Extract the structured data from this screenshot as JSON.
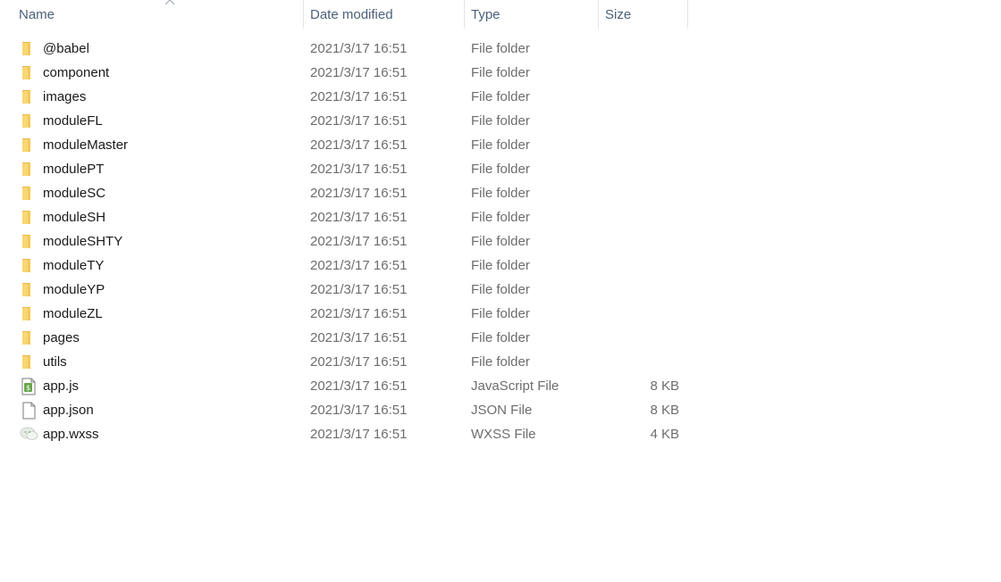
{
  "columns": {
    "name": "Name",
    "date": "Date modified",
    "type": "Type",
    "size": "Size"
  },
  "sort": {
    "column": "name",
    "direction": "ascending"
  },
  "colors": {
    "header_text": "#4c607a",
    "folder_yellow": "#f8d775",
    "folder_dark": "#e6b84a",
    "secondary_text": "#6d6d6d"
  },
  "files": [
    {
      "name": "@babel",
      "date": "2021/3/17 16:51",
      "type": "File folder",
      "size": "",
      "icon": "folder-icon"
    },
    {
      "name": "component",
      "date": "2021/3/17 16:51",
      "type": "File folder",
      "size": "",
      "icon": "folder-icon"
    },
    {
      "name": "images",
      "date": "2021/3/17 16:51",
      "type": "File folder",
      "size": "",
      "icon": "folder-icon"
    },
    {
      "name": "moduleFL",
      "date": "2021/3/17 16:51",
      "type": "File folder",
      "size": "",
      "icon": "folder-icon"
    },
    {
      "name": "moduleMaster",
      "date": "2021/3/17 16:51",
      "type": "File folder",
      "size": "",
      "icon": "folder-icon"
    },
    {
      "name": "modulePT",
      "date": "2021/3/17 16:51",
      "type": "File folder",
      "size": "",
      "icon": "folder-icon"
    },
    {
      "name": "moduleSC",
      "date": "2021/3/17 16:51",
      "type": "File folder",
      "size": "",
      "icon": "folder-icon"
    },
    {
      "name": "moduleSH",
      "date": "2021/3/17 16:51",
      "type": "File folder",
      "size": "",
      "icon": "folder-icon"
    },
    {
      "name": "moduleSHTY",
      "date": "2021/3/17 16:51",
      "type": "File folder",
      "size": "",
      "icon": "folder-icon"
    },
    {
      "name": "moduleTY",
      "date": "2021/3/17 16:51",
      "type": "File folder",
      "size": "",
      "icon": "folder-icon"
    },
    {
      "name": "moduleYP",
      "date": "2021/3/17 16:51",
      "type": "File folder",
      "size": "",
      "icon": "folder-icon"
    },
    {
      "name": "moduleZL",
      "date": "2021/3/17 16:51",
      "type": "File folder",
      "size": "",
      "icon": "folder-icon"
    },
    {
      "name": "pages",
      "date": "2021/3/17 16:51",
      "type": "File folder",
      "size": "",
      "icon": "folder-icon"
    },
    {
      "name": "utils",
      "date": "2021/3/17 16:51",
      "type": "File folder",
      "size": "",
      "icon": "folder-icon"
    },
    {
      "name": "app.js",
      "date": "2021/3/17 16:51",
      "type": "JavaScript File",
      "size": "8 KB",
      "icon": "javascript-file-icon"
    },
    {
      "name": "app.json",
      "date": "2021/3/17 16:51",
      "type": "JSON File",
      "size": "8 KB",
      "icon": "blank-file-icon"
    },
    {
      "name": "app.wxss",
      "date": "2021/3/17 16:51",
      "type": "WXSS File",
      "size": "4 KB",
      "icon": "wechat-file-icon"
    }
  ]
}
